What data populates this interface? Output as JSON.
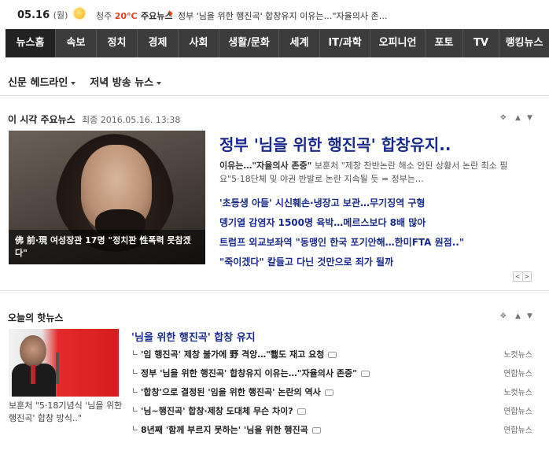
{
  "topbar": {
    "date": "05.16",
    "dow": "(월)",
    "city": "청주",
    "temp": "20°C",
    "ticker_label": "주요뉴스",
    "ticker_text": "정부 '님을 위한 행진곡' 합창유지 이유는…\"자율의사 존…"
  },
  "nav": {
    "items": [
      "뉴스홈",
      "속보",
      "정치",
      "경제",
      "사회",
      "생활/문화",
      "세계",
      "IT/과학",
      "오피니언",
      "포토",
      "TV",
      "랭킹뉴스"
    ]
  },
  "subnav": {
    "paper": "신문 헤드라인",
    "evening": "저녁 방송 뉴스"
  },
  "main": {
    "section_title": "이 시각 주요뉴스",
    "updated": "최종 2016.05.16. 13:38",
    "photo_caption": "佛 前·現 여성장관 17명 \"정치판 性폭력 못참겠다\"",
    "headline": "정부 '님을 위한 행진곡' 합창유지..",
    "summary_lead": "이유는…\"자율의사 존중\"",
    "summary_rest": " 보훈처 \"제창 찬반논란 해소 안된 상황서 논란 최소 필요\"5·18단체 및 야권 반발로 논란 지속될 듯 = 정부는…",
    "headlines": [
      "'초등생 아들' 시신훼손·냉장고 보관…무기징역 구형",
      "뎅기열 감염자 1500명 육박…메르스보다 8배 많아",
      "트럼프 외교보좌역 \"동맹인 한국 포기안해…한미FTA 원점..\"",
      "\"죽이겠다\" 칼들고 다닌 것만으로 죄가 될까"
    ],
    "pager_prev": "<",
    "pager_next": ">"
  },
  "hot": {
    "section_title": "오늘의 핫뉴스",
    "photo_caption": "보훈처 \"5·18기념식 '님을 위한 행진곡' 합창 방식..\"",
    "title": "'님을 위한 행진곡' 합창 유지",
    "rows": [
      {
        "text": "'임 행진곡' 제창 불가에 野 격앙…\"뾇도 재고 요청",
        "source": "노컷뉴스"
      },
      {
        "text": "정부 '님을 위한 행진곡' 합창유지 이유는…\"자율의사 존중\"",
        "source": "연합뉴스"
      },
      {
        "text": "'합창'으로 결정된 '임을 위한 행진곡' 논란의 역사",
        "source": "노컷뉴스"
      },
      {
        "text": "'님~행진곡' 합창·제창 도대체 무슨 차이?",
        "source": "연합뉴스"
      },
      {
        "text": "8년째 '함께 부르지 못하는' '님을 위한 행진곡",
        "source": "연합뉴스"
      }
    ]
  },
  "icons": {
    "weather": "sun-icon",
    "camera": "camera-icon"
  },
  "colors": {
    "nav_bg": "#3c3c3c",
    "headline_blue": "#1a2a8c",
    "accent_red": "#e0421d"
  }
}
